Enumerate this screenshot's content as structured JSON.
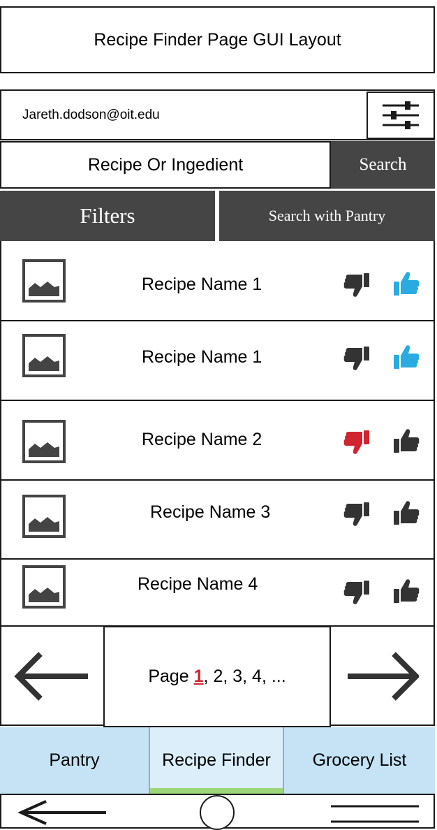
{
  "page_title": "Recipe Finder Page GUI Layout",
  "user": {
    "email": "Jareth.dodson@oit.edu",
    "filter_icon": "sliders-icon"
  },
  "search": {
    "placeholder": "Recipe Or Ingedient",
    "button_label": "Search"
  },
  "actions": {
    "filters_label": "Filters",
    "pantry_search_label": "Search with Pantry"
  },
  "recipes": [
    {
      "name": "Recipe Name 1",
      "disliked": false,
      "liked": true
    },
    {
      "name": "Recipe Name 1",
      "disliked": false,
      "liked": true
    },
    {
      "name": "Recipe Name 2",
      "disliked": true,
      "liked": false
    },
    {
      "name": "Recipe Name 3",
      "disliked": false,
      "liked": false
    },
    {
      "name": "Recipe Name 4",
      "disliked": false,
      "liked": false
    }
  ],
  "pagination": {
    "prefix": "Page ",
    "current": "1",
    "rest": ", 2, 3, 4, ..."
  },
  "tabs": {
    "pantry": "Pantry",
    "recipe_finder": "Recipe Finder",
    "grocery_list": "Grocery List",
    "active": "Recipe Finder"
  },
  "colors": {
    "dark_button": "#454545",
    "like_active": "#29abe2",
    "dislike_active": "#d1242f",
    "thumb_inactive": "#333333",
    "tab_bg": "#c5e3f5",
    "active_tab_indicator": "#9dd77a"
  }
}
